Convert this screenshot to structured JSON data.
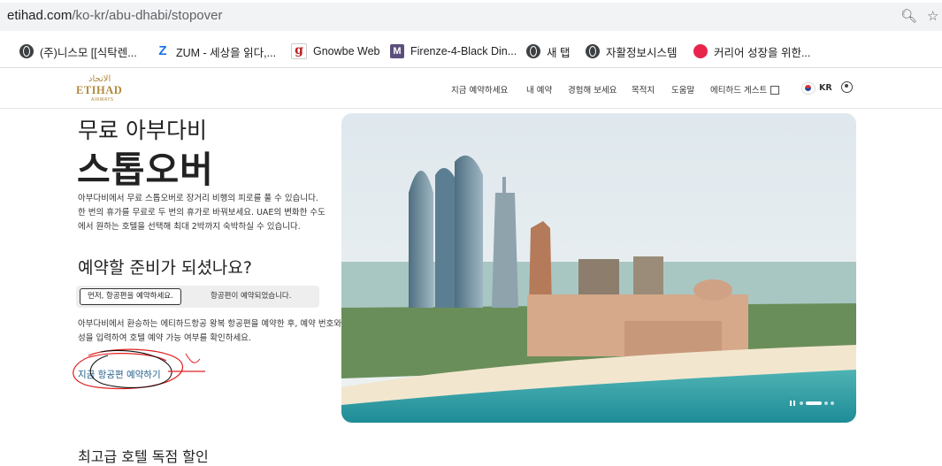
{
  "browser": {
    "url_host": "etihad.com",
    "url_path": "/ko-kr/abu-dhabi/stopover",
    "icons": [
      "zoom-icon",
      "star-icon"
    ],
    "bookmarks": [
      {
        "label": "(주)니스모 [[식탁렌...",
        "icon": "globe-icon"
      },
      {
        "label": "ZUM - 세상을 읽다,...",
        "icon": "zum-icon"
      },
      {
        "label": "Gnowbe Web",
        "icon": "gnowbe-icon"
      },
      {
        "label": "Firenze-4-Black Din...",
        "icon": "m-icon"
      },
      {
        "label": "새 탭",
        "icon": "globe-icon"
      },
      {
        "label": "자활정보시스템",
        "icon": "globe-icon"
      },
      {
        "label": "커리어 성장을 위한...",
        "icon": "pink-icon"
      }
    ]
  },
  "header": {
    "logo_arabic": "الاتحاد",
    "logo_word": "ETIHAD",
    "logo_sub": "AIRWAYS",
    "nav": [
      "지금 예약하세요",
      "내 예약",
      "경험해 보세요",
      "목적지",
      "도움말",
      "에티하드 게스트"
    ],
    "lang": "KR"
  },
  "main": {
    "title_small": "무료 아부다비",
    "title_big": "스톱오버",
    "description": "아부다비에서 무료 스톱오버로 장거리 비행의 피로를 풀 수 있습니다. 한 번의 휴가를 무료로 두 번의 휴가로 바꿔보세요. UAE의 변화한 수도에서 원하는 호텔을 선택해 최대 2박까지 숙박하실 수 있습니다.",
    "question": "예약할 준비가 되셨나요?",
    "tab_active": "먼저, 항공편을 예약하세요.",
    "tab_inactive": "항공편이 예약되었습니다.",
    "info": "아부다비에서 환승하는 에티하드항공 왕복 항공편을 예약한 후, 예약 번호와 성을 입력하여 호텔 예약 가능 여부를 확인하세요.",
    "book_link": "지금 항공편 예약하기",
    "hotels_heading": "최고급 호텔 독점 할인"
  },
  "colors": {
    "brand_gold": "#b08a3e",
    "link": "#1f5f8a",
    "annotation_red": "#e02020"
  }
}
